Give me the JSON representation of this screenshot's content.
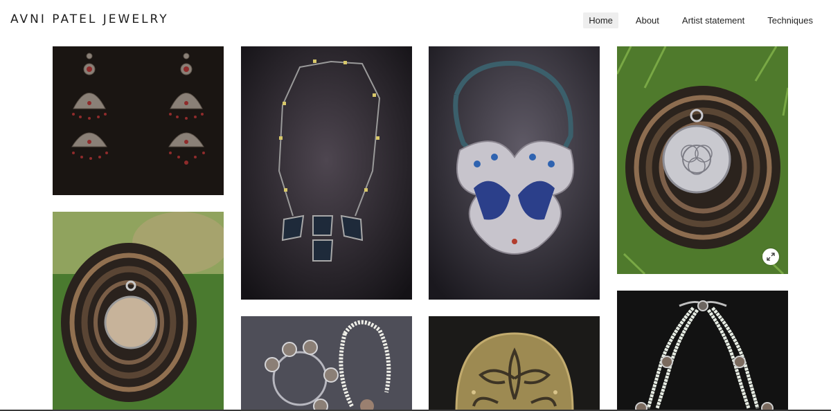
{
  "site": {
    "title": "AVNI PATEL JEWELRY"
  },
  "nav": [
    {
      "label": "Home",
      "active": true
    },
    {
      "label": "About",
      "active": false
    },
    {
      "label": "Artist statement",
      "active": false
    },
    {
      "label": "Techniques",
      "active": false
    }
  ],
  "gallery": {
    "items": [
      {
        "subject": "silver jhumka earrings with red stones"
      },
      {
        "subject": "square link necklace with blue enamel pendants"
      },
      {
        "subject": "twisted cord necklace with enamel birds pendant"
      },
      {
        "subject": "round silver pendant on wood slice"
      },
      {
        "subject": "round stone pendant on wood slice"
      },
      {
        "subject": "silver bangle and bead necklace"
      },
      {
        "subject": "brass half-moon filigree brooch"
      },
      {
        "subject": "pearl strand necklace"
      }
    ],
    "expand_icon": "expand-icon"
  }
}
